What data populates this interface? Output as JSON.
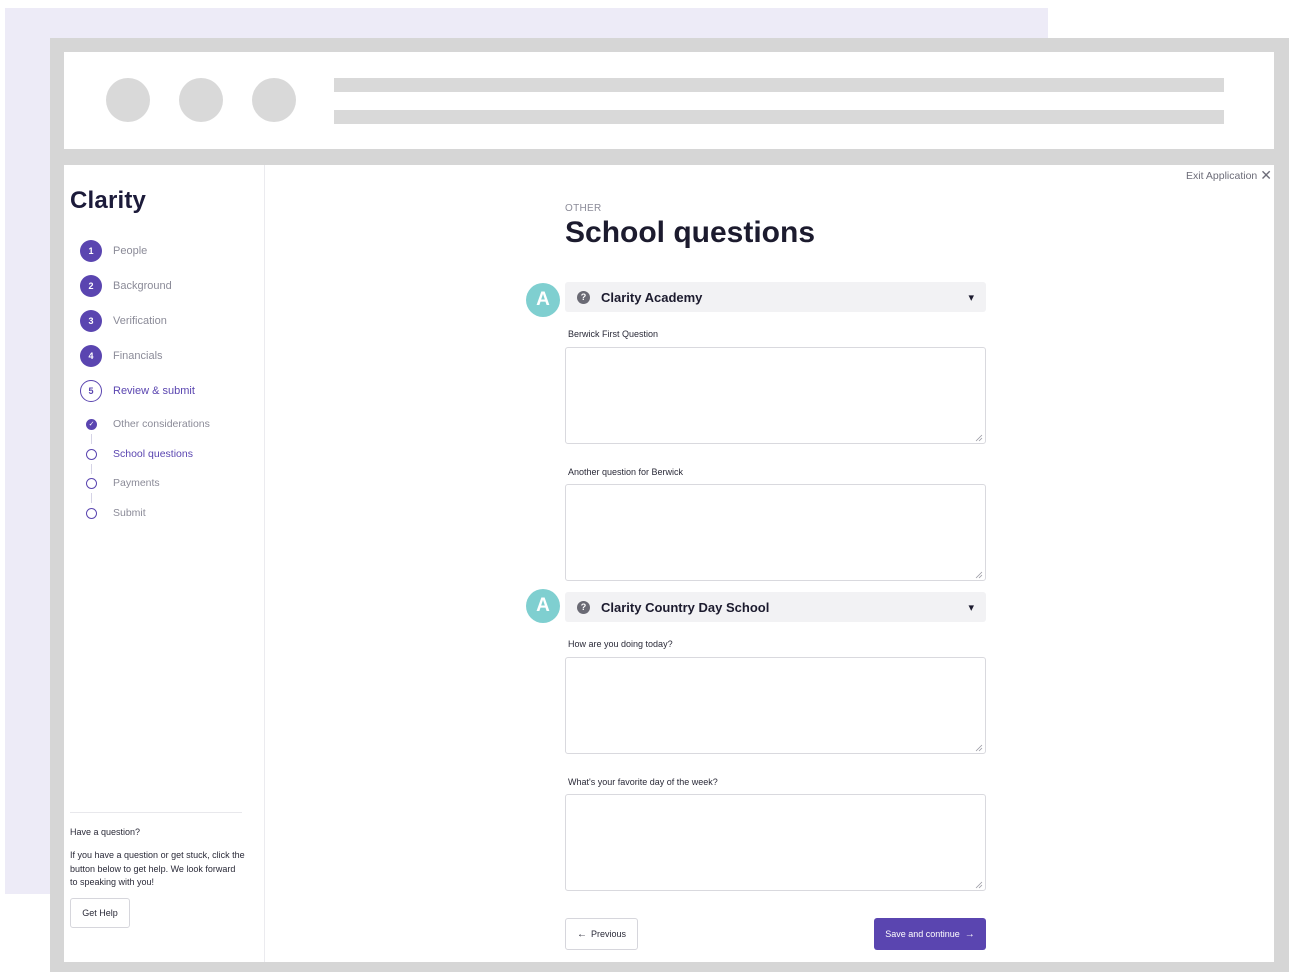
{
  "app": {
    "logo": "Clarity",
    "exit_label": "Exit Application",
    "exit_icon": "✕"
  },
  "sidebar": {
    "steps": [
      {
        "num": "1",
        "label": "People",
        "state": "done"
      },
      {
        "num": "2",
        "label": "Background",
        "state": "done"
      },
      {
        "num": "3",
        "label": "Verification",
        "state": "done"
      },
      {
        "num": "4",
        "label": "Financials",
        "state": "done"
      },
      {
        "num": "5",
        "label": "Review & submit",
        "state": "current"
      }
    ],
    "substeps": [
      {
        "label": "Other considerations",
        "state": "done"
      },
      {
        "label": "School questions",
        "state": "current"
      },
      {
        "label": "Payments",
        "state": "todo"
      },
      {
        "label": "Submit",
        "state": "todo"
      }
    ],
    "help": {
      "title": "Have a question?",
      "text": "If you have a question or get stuck, click the button below to get help. We look forward to speaking with you!",
      "button": "Get Help"
    }
  },
  "main": {
    "eyebrow": "OTHER",
    "title": "School questions",
    "badge_label": "A",
    "schools": [
      {
        "name": "Clarity Academy",
        "questions": [
          {
            "label": "Berwick First Question",
            "value": ""
          },
          {
            "label": "Another question for Berwick",
            "value": ""
          }
        ]
      },
      {
        "name": "Clarity Country Day School",
        "questions": [
          {
            "label": "How are you doing today?",
            "value": ""
          },
          {
            "label": "What's your favorite day of the week?",
            "value": ""
          }
        ]
      }
    ],
    "prev_label": "Previous",
    "prev_icon": "←",
    "next_label": "Save and continue",
    "next_icon": "→",
    "chevron_icon": "⌄",
    "help_icon": "?"
  },
  "colors": {
    "brand": "#5a45b0",
    "badge": "#7fcfd0",
    "backdrop": "#edebf7"
  }
}
